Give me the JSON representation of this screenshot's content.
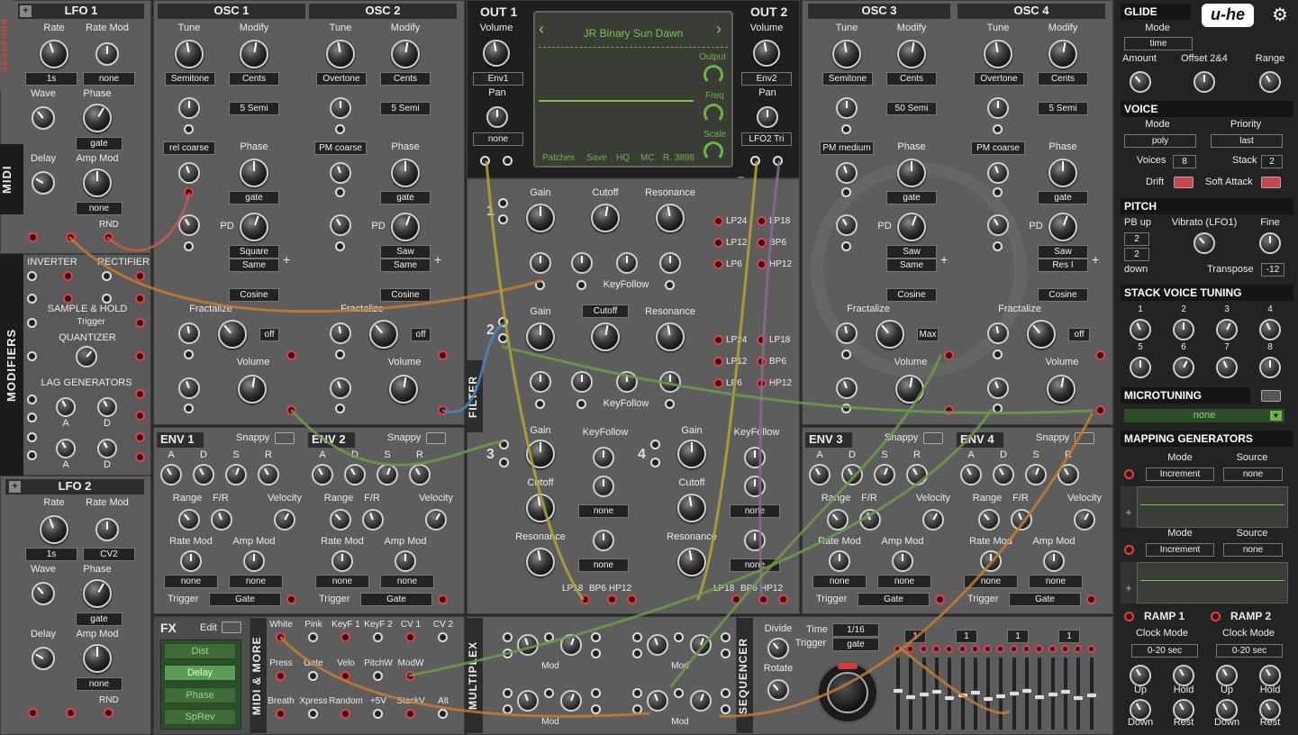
{
  "lfo1": {
    "title": "LFO 1",
    "rate": "Rate",
    "rate_mod": "Rate Mod",
    "rate_val": "1s",
    "rate_mod_val": "none",
    "wave": "Wave",
    "phase": "Phase",
    "phase_val": "gate",
    "delay": "Delay",
    "amp_mod": "Amp Mod",
    "amp_mod_val": "none",
    "rnd": "RND"
  },
  "lfo2": {
    "title": "LFO 2",
    "rate": "Rate",
    "rate_mod": "Rate Mod",
    "rate_val": "1s",
    "rate_mod_val": "CV2",
    "wave": "Wave",
    "phase": "Phase",
    "phase_val": "gate",
    "delay": "Delay",
    "amp_mod": "Amp Mod",
    "amp_mod_val": "none",
    "rnd": "RND"
  },
  "side": {
    "gearporn": "GEARPORN",
    "midi": "MIDI",
    "modifiers": "MODIFIERS",
    "filter": "FILTER",
    "midi_more": "MIDI & MORE",
    "multiplex": "MULTIPLEX",
    "sequencer": "SEQUENCER"
  },
  "modifiers": {
    "inverter": "INVERTER",
    "rectifier": "RECTIFIER",
    "sample_hold": "SAMPLE & HOLD",
    "trigger": "Trigger",
    "quantizer": "QUANTIZER",
    "lag": "LAG GENERATORS",
    "a": "A",
    "d": "D"
  },
  "osc1": {
    "title": "OSC 1",
    "tune": "Tune",
    "modify": "Modify",
    "tune_val": "Semitone",
    "modify_val": "Cents",
    "semi": "5 Semi",
    "mod_mode": "rel coarse",
    "phase": "Phase",
    "phase_val": "gate",
    "pd": "PD",
    "wave1": "Square",
    "wave2": "Same",
    "cosine": "Cosine",
    "fractalize": "Fractalize",
    "frac_val": "off",
    "volume": "Volume"
  },
  "osc2": {
    "title": "OSC 2",
    "tune": "Tune",
    "modify": "Modify",
    "tune_val": "Overtone",
    "modify_val": "Cents",
    "semi": "5 Semi",
    "mod_mode": "PM coarse",
    "phase": "Phase",
    "phase_val": "gate",
    "pd": "PD",
    "wave1": "Saw",
    "wave2": "Same",
    "cosine": "Cosine",
    "fractalize": "Fractalize",
    "frac_val": "off",
    "volume": "Volume"
  },
  "osc3": {
    "title": "OSC 3",
    "tune": "Tune",
    "modify": "Modify",
    "tune_val": "Semitone",
    "modify_val": "Cents",
    "semi": "50 Semi",
    "mod_mode": "PM medium",
    "phase": "Phase",
    "phase_val": "gate",
    "pd": "PD",
    "wave1": "Saw",
    "wave2": "Same",
    "cosine": "Cosine",
    "fractalize": "Fractalize",
    "frac_val": "Max",
    "volume": "Volume"
  },
  "osc4": {
    "title": "OSC 4",
    "tune": "Tune",
    "modify": "Modify",
    "tune_val": "Overtone",
    "modify_val": "Cents",
    "semi": "5 Semi",
    "mod_mode": "PM coarse",
    "phase": "Phase",
    "phase_val": "gate",
    "pd": "PD",
    "wave1": "Saw",
    "wave2": "Res I",
    "cosine": "Cosine",
    "fractalize": "Fractalize",
    "frac_val": "off",
    "volume": "Volume"
  },
  "out1": {
    "title": "OUT 1",
    "volume": "Volume",
    "vol_val": "Env1",
    "pan": "Pan",
    "pan_val": "none"
  },
  "out2": {
    "title": "OUT 2",
    "volume": "Volume",
    "vol_val": "Env2",
    "pan": "Pan",
    "pan_val": "LFO2 Tri"
  },
  "display": {
    "patch": "JR Binary Sun Dawn",
    "output": "Output",
    "freq": "Freq",
    "scale": "Scale",
    "patches": "Patches",
    "save": "Save",
    "hq": "HQ",
    "mc": "MC",
    "rev": "R. 3898"
  },
  "filter": {
    "gain": "Gain",
    "cutoff": "Cutoff",
    "resonance": "Resonance",
    "keyfollow": "KeyFollow",
    "lp24": "LP24",
    "lp12": "LP12",
    "lp6": "LP6",
    "lp18": "LP18",
    "bp6": "BP6",
    "hp12": "HP12",
    "none": "none",
    "n1": "1",
    "n2": "2",
    "n3": "3",
    "n4": "4"
  },
  "env": {
    "env1": "ENV 1",
    "env2": "ENV 2",
    "env3": "ENV 3",
    "env4": "ENV 4",
    "snappy": "Snappy",
    "a": "A",
    "d": "D",
    "s": "S",
    "r": "R",
    "range": "Range",
    "fr": "F/R",
    "velocity": "Velocity",
    "rate_mod": "Rate Mod",
    "amp_mod": "Amp Mod",
    "none": "none",
    "trigger": "Trigger",
    "gate": "Gate"
  },
  "fx": {
    "title": "FX",
    "edit": "Edit",
    "items": [
      "Dist",
      "Delay",
      "Phase",
      "SpRev"
    ]
  },
  "midi_more": {
    "row1": [
      "White",
      "Pink",
      "KeyF 1",
      "KeyF 2",
      "CV 1",
      "CV 2"
    ],
    "row2": [
      "Press",
      "Gate",
      "Velo",
      "PitchW",
      "ModW"
    ],
    "row3": [
      "Breath",
      "Xpress",
      "Random",
      "+5V",
      "StackV",
      "Alt"
    ]
  },
  "multiplex": {
    "mod": "Mod"
  },
  "sequencer": {
    "divide": "Divide",
    "time": "Time",
    "time_val": "1/16",
    "trigger": "Trigger",
    "trigger_val": "gate",
    "rotate": "Rotate",
    "steps": [
      "1",
      "1",
      "1",
      "1"
    ]
  },
  "glide": {
    "title": "GLIDE",
    "mode": "Mode",
    "mode_val": "time",
    "amount": "Amount",
    "offset": "Offset 2&4",
    "range": "Range"
  },
  "voice": {
    "title": "VOICE",
    "mode": "Mode",
    "mode_val": "poly",
    "priority": "Priority",
    "priority_val": "last",
    "voices": "Voices",
    "voices_val": "8",
    "stack": "Stack",
    "stack_val": "2",
    "drift": "Drift",
    "soft_attack": "Soft Attack"
  },
  "pitch": {
    "title": "PITCH",
    "pb_up": "PB up",
    "pb_up_val": "2",
    "pb_down_val": "2",
    "down": "down",
    "vibrato": "Vibrato (LFO1)",
    "fine": "Fine",
    "transpose": "Transpose",
    "transpose_val": "-12"
  },
  "svt": {
    "title": "STACK VOICE TUNING",
    "nums": [
      "1",
      "2",
      "3",
      "4",
      "5",
      "6",
      "7",
      "8"
    ]
  },
  "microtuning": {
    "title": "MICROTUNING",
    "val": "none"
  },
  "mapgen": {
    "title": "MAPPING GENERATORS",
    "mode": "Mode",
    "source": "Source",
    "mode_val": "Increment",
    "source_val": "none"
  },
  "ramp": {
    "ramp1": "RAMP 1",
    "ramp2": "RAMP 2",
    "clock": "Clock Mode",
    "clock_val": "0-20 sec",
    "up": "Up",
    "hold": "Hold",
    "down": "Down",
    "rest": "Rest"
  },
  "brand": {
    "logo": "u-he"
  }
}
